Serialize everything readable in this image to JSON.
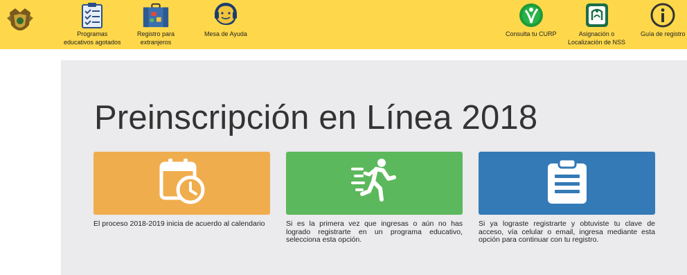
{
  "header": {
    "nav_left": [
      {
        "label": "Programas\neducativos agotados",
        "icon": "clipboard-checklist-icon"
      },
      {
        "label": "Registro para\nextranjeros",
        "icon": "suitcase-icon"
      },
      {
        "label": "Mesa de Ayuda",
        "icon": "headset-support-icon"
      }
    ],
    "nav_right": [
      {
        "label": "Consulta tu CURP",
        "icon": "curp-icon"
      },
      {
        "label": "Asignación o\nLocalización de NSS",
        "icon": "imss-icon"
      },
      {
        "label": "Guía de registro",
        "icon": "info-icon"
      }
    ]
  },
  "main": {
    "title": "Preinscripción en Línea 2018",
    "cards": [
      {
        "icon": "calendar-clock-icon",
        "color": "#f0ad4e",
        "text": "El proceso 2018-2019 inicia de acuerdo al calendario"
      },
      {
        "icon": "running-person-icon",
        "color": "#5cb85c",
        "text": "Si es la primera vez que ingresas o aún no has logrado registrarte en un programa educativo, selecciona esta opción."
      },
      {
        "icon": "clipboard-list-icon",
        "color": "#337ab7",
        "text": "Si ya lograste registrarte y obtuviste tu clave de acceso, vía celular o email, ingresa mediante esta opción para continuar con tu registro."
      }
    ]
  },
  "colors": {
    "topbar": "#fed84a",
    "panel": "#ebeaec"
  }
}
